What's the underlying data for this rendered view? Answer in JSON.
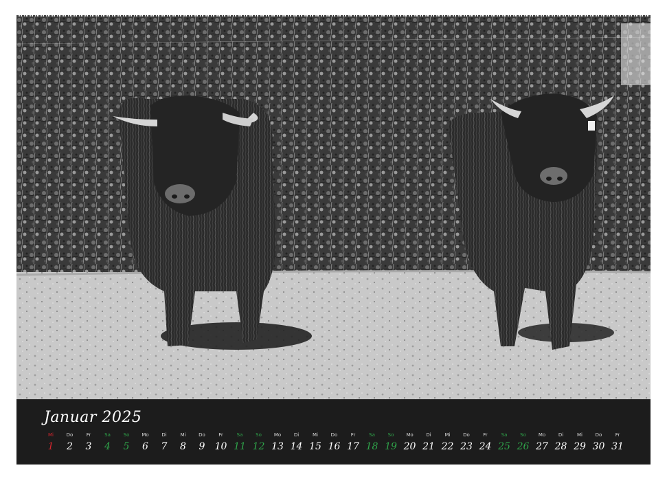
{
  "month_title": "Januar 2025",
  "colors": {
    "strip_background": "#1c1c1c",
    "weekday_text": "#ffffff",
    "weekend_text": "#2fa44a",
    "holiday_text": "#d2262e"
  },
  "days": [
    {
      "wd": "Mi",
      "dn": "1",
      "kind": "holiday"
    },
    {
      "wd": "Do",
      "dn": "2",
      "kind": "weekday"
    },
    {
      "wd": "Fr",
      "dn": "3",
      "kind": "weekday"
    },
    {
      "wd": "Sa",
      "dn": "4",
      "kind": "weekend"
    },
    {
      "wd": "So",
      "dn": "5",
      "kind": "weekend"
    },
    {
      "wd": "Mo",
      "dn": "6",
      "kind": "weekday"
    },
    {
      "wd": "Di",
      "dn": "7",
      "kind": "weekday"
    },
    {
      "wd": "Mi",
      "dn": "8",
      "kind": "weekday"
    },
    {
      "wd": "Do",
      "dn": "9",
      "kind": "weekday"
    },
    {
      "wd": "Fr",
      "dn": "10",
      "kind": "weekday"
    },
    {
      "wd": "Sa",
      "dn": "11",
      "kind": "weekend"
    },
    {
      "wd": "So",
      "dn": "12",
      "kind": "weekend"
    },
    {
      "wd": "Mo",
      "dn": "13",
      "kind": "weekday"
    },
    {
      "wd": "Di",
      "dn": "14",
      "kind": "weekday"
    },
    {
      "wd": "Mi",
      "dn": "15",
      "kind": "weekday"
    },
    {
      "wd": "Do",
      "dn": "16",
      "kind": "weekday"
    },
    {
      "wd": "Fr",
      "dn": "17",
      "kind": "weekday"
    },
    {
      "wd": "Sa",
      "dn": "18",
      "kind": "weekend"
    },
    {
      "wd": "So",
      "dn": "19",
      "kind": "weekend"
    },
    {
      "wd": "Mo",
      "dn": "20",
      "kind": "weekday"
    },
    {
      "wd": "Di",
      "dn": "21",
      "kind": "weekday"
    },
    {
      "wd": "Mi",
      "dn": "22",
      "kind": "weekday"
    },
    {
      "wd": "Do",
      "dn": "23",
      "kind": "weekday"
    },
    {
      "wd": "Fr",
      "dn": "24",
      "kind": "weekday"
    },
    {
      "wd": "Sa",
      "dn": "25",
      "kind": "weekend"
    },
    {
      "wd": "So",
      "dn": "26",
      "kind": "weekend"
    },
    {
      "wd": "Mo",
      "dn": "27",
      "kind": "weekday"
    },
    {
      "wd": "Di",
      "dn": "28",
      "kind": "weekday"
    },
    {
      "wd": "Mi",
      "dn": "29",
      "kind": "weekday"
    },
    {
      "wd": "Do",
      "dn": "30",
      "kind": "weekday"
    },
    {
      "wd": "Fr",
      "dn": "31",
      "kind": "weekday"
    }
  ]
}
